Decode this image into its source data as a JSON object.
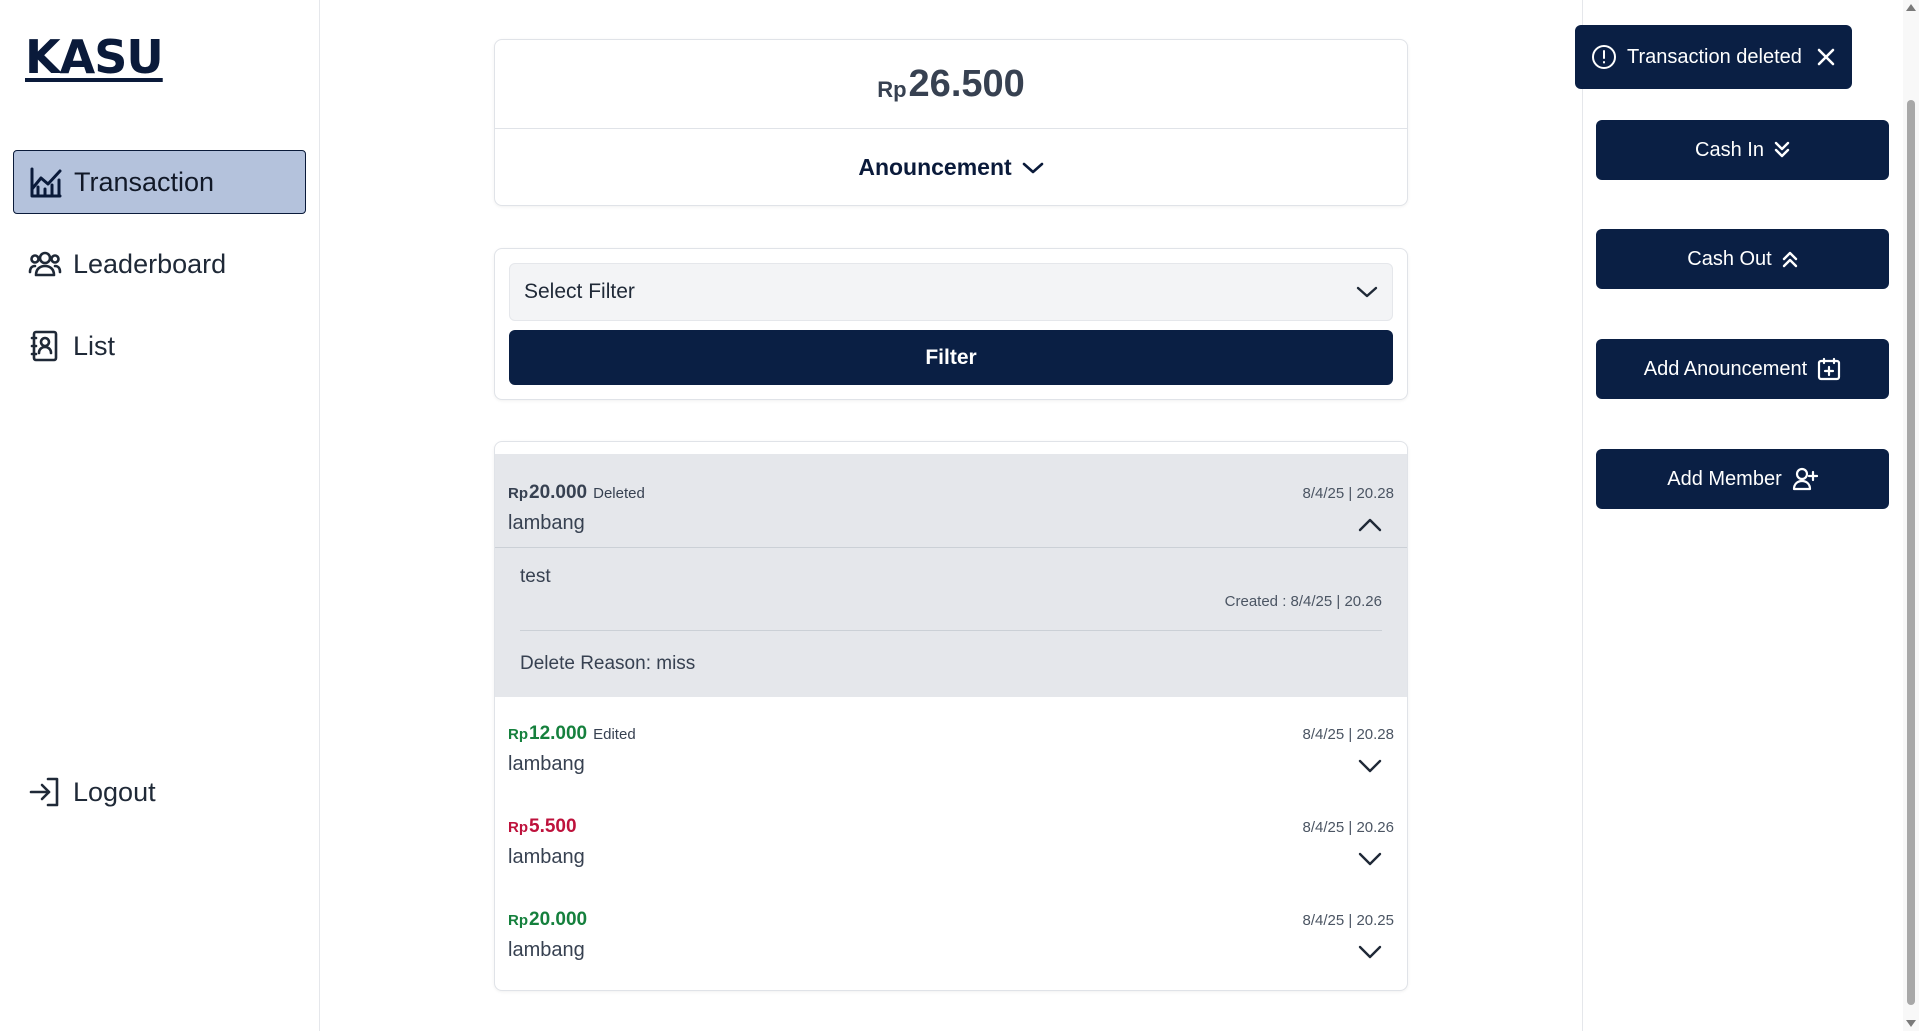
{
  "app": {
    "logo": "KASU"
  },
  "sidebar": {
    "items": [
      {
        "label": "Transaction",
        "icon": "chart-line-icon",
        "active": true
      },
      {
        "label": "Leaderboard",
        "icon": "users-icon",
        "active": false
      },
      {
        "label": "List",
        "icon": "contact-book-icon",
        "active": false
      }
    ],
    "logout": {
      "label": "Logout",
      "icon": "logout-icon"
    }
  },
  "balance": {
    "currency": "Rp",
    "amount": "26.500"
  },
  "announcement": {
    "label": "Anouncement"
  },
  "filter": {
    "select_value": "Select Filter",
    "button_label": "Filter"
  },
  "transactions": [
    {
      "currency": "Rp",
      "amount": "20.000",
      "tag": "Deleted",
      "name": "lambang",
      "date": "8/4/25 | 20.28",
      "expanded": true,
      "note": "test",
      "created": "Created : 8/4/25 | 20.26",
      "delete_reason": "Delete Reason: miss"
    },
    {
      "currency": "Rp",
      "amount": "12.000",
      "tag": "Edited",
      "name": "lambang",
      "date": "8/4/25 | 20.28",
      "type": "in"
    },
    {
      "currency": "Rp",
      "amount": "5.500",
      "tag": "",
      "name": "lambang",
      "date": "8/4/25 | 20.26",
      "type": "out"
    },
    {
      "currency": "Rp",
      "amount": "20.000",
      "tag": "",
      "name": "lambang",
      "date": "8/4/25 | 20.25",
      "type": "in"
    }
  ],
  "toast": {
    "message": "Transaction deleted"
  },
  "actions": {
    "cash_in": "Cash In",
    "cash_out": "Cash Out",
    "add_announcement": "Add Anouncement",
    "add_member": "Add Member"
  },
  "colors": {
    "primary": "#0a1f44",
    "active_nav": "#b4c2dc",
    "cash_in": "#15803d",
    "cash_out": "#be123c"
  }
}
